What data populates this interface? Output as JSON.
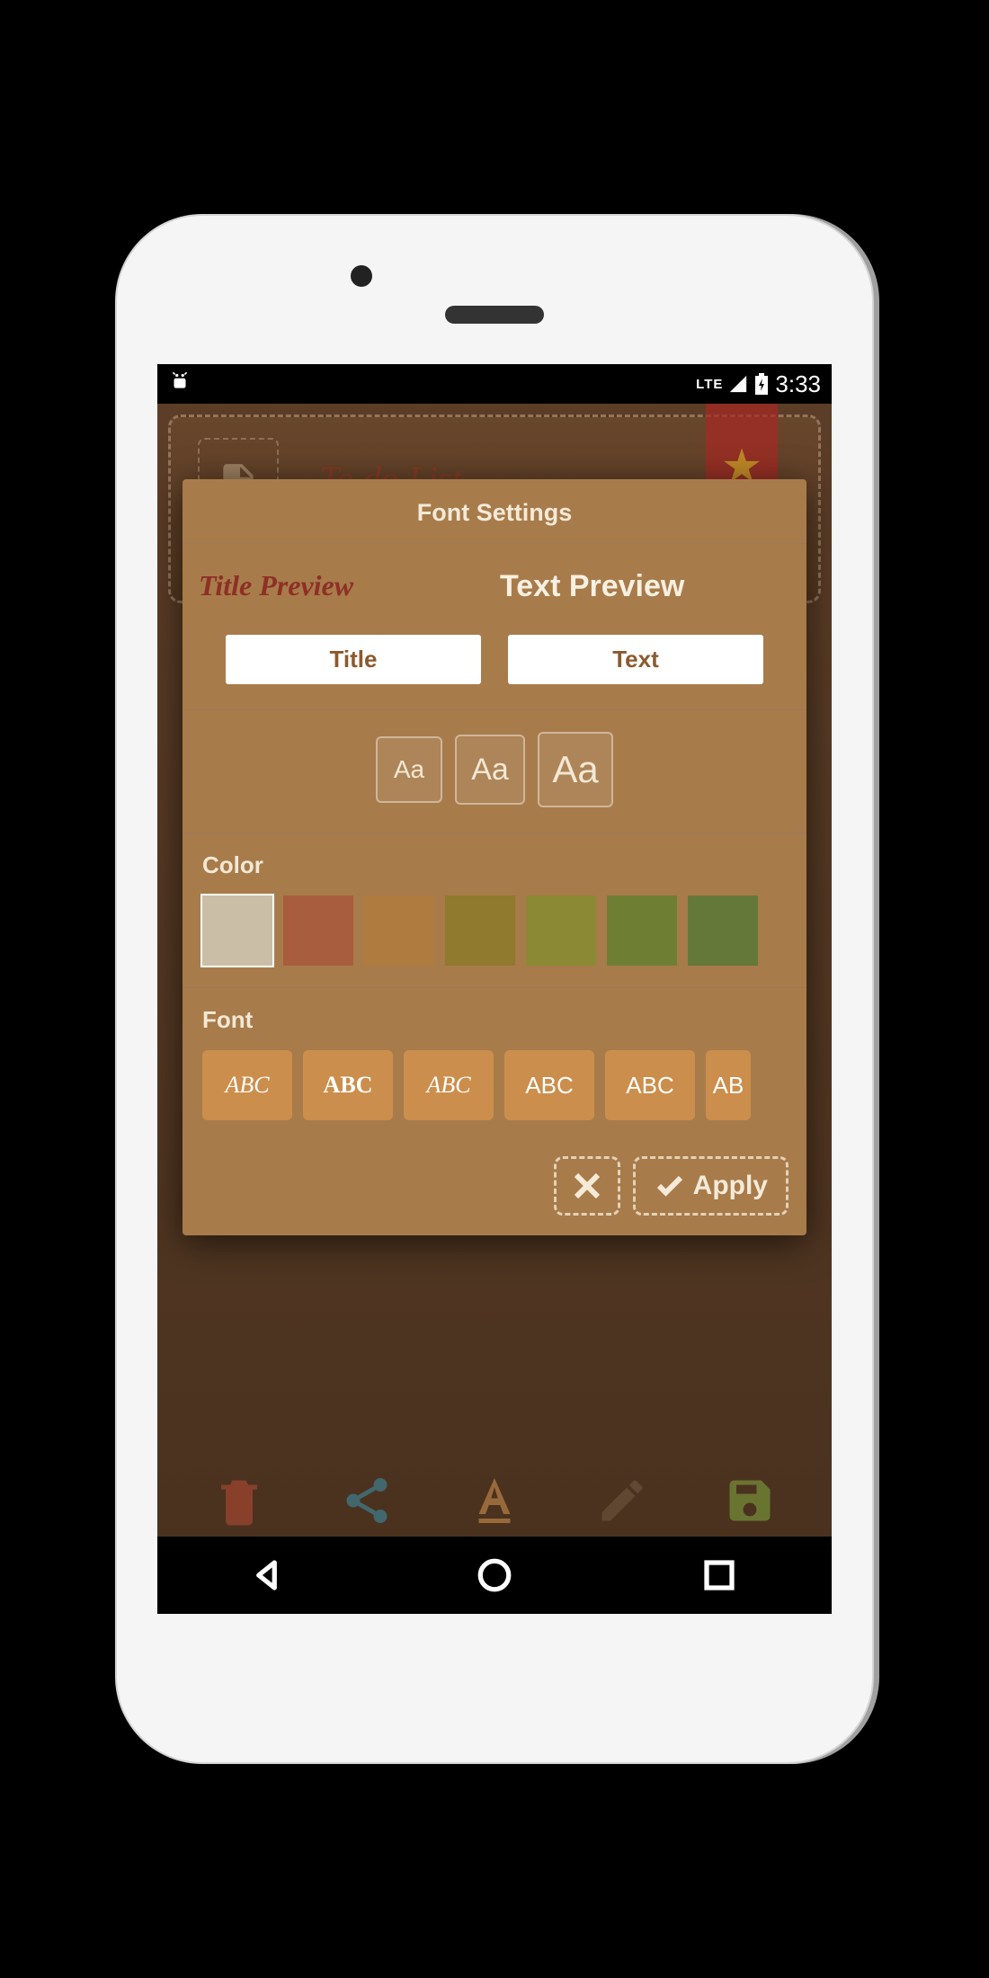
{
  "status": {
    "lte": "LTE",
    "time": "3:33"
  },
  "background": {
    "title": "To do List"
  },
  "dialog": {
    "title": "Font Settings",
    "title_preview": "Title Preview",
    "text_preview": "Text Preview",
    "tab_title": "Title",
    "tab_text": "Text",
    "size_small": "Aa",
    "size_med": "Aa",
    "size_large": "Aa",
    "color_label": "Color",
    "colors": [
      "#cbbea7",
      "#a85d3f",
      "#b07b3f",
      "#8f7a2e",
      "#8b8934",
      "#6e7f33",
      "#64783a"
    ],
    "font_label": "Font",
    "font_samples": [
      "ABC",
      "ABC",
      "ABC",
      "ABC",
      "ABC",
      "AB"
    ],
    "apply": "Apply"
  }
}
